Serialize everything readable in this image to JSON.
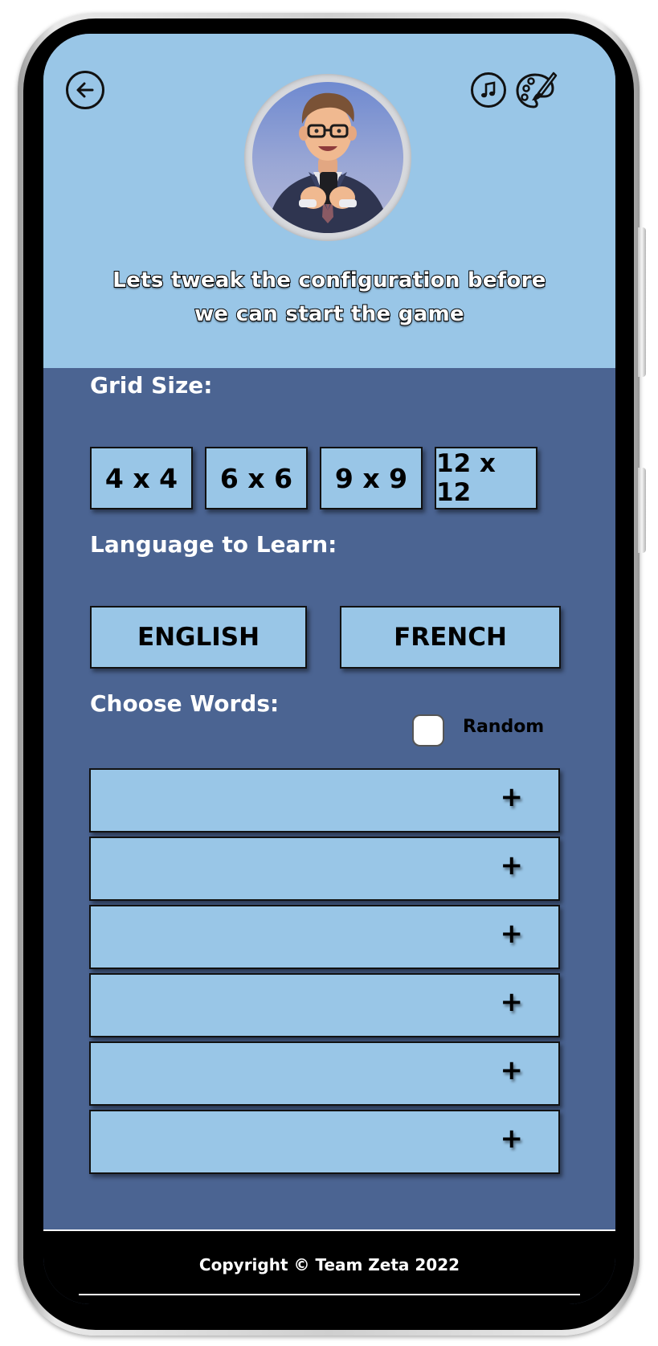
{
  "header": {
    "back_icon": "arrow-left-icon",
    "music_icon": "music-note-icon",
    "theme_icon": "palette-icon",
    "avatar": "man-with-glasses-holding-phone",
    "intro_line1": "Lets tweak the configuration before",
    "intro_line2": "we can start the game"
  },
  "grid_size": {
    "label": "Grid Size:",
    "options": [
      "4 x 4",
      "6 x 6",
      "9 x 9",
      "12 x 12"
    ]
  },
  "language": {
    "label": "Language to Learn:",
    "options": [
      "ENGLISH",
      "FRENCH"
    ]
  },
  "words": {
    "label": "Choose Words:",
    "random_label": "Random",
    "random_checked": false,
    "add_symbol": "+",
    "row_count": 6
  },
  "footer": {
    "copyright": "Copyright © Team Zeta 2022"
  },
  "colors": {
    "header_bg": "#99c6e7",
    "panel_bg": "#4b6492",
    "option_bg": "#99c6e7",
    "footer_bg": "#000000"
  }
}
